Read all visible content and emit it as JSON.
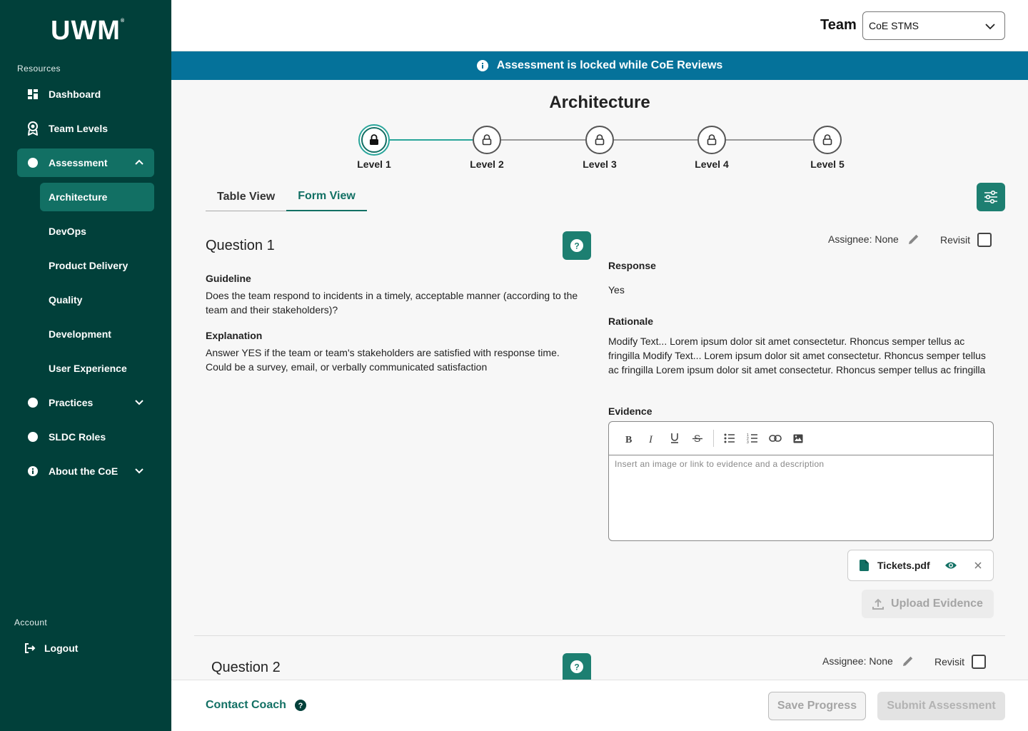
{
  "sidebar": {
    "logo": "UWM",
    "logo_mark": "®",
    "resources_label": "Resources",
    "items": {
      "dashboard": "Dashboard",
      "team_levels": "Team Levels",
      "assessment": "Assessment",
      "practices": "Practices",
      "sldc_roles": "SLDC Roles",
      "about": "About the CoE"
    },
    "sub_items": [
      "Architecture",
      "DevOps",
      "Product Delivery",
      "Quality",
      "Development",
      "User Experience"
    ],
    "active_sub_item": "Architecture",
    "account_label": "Account",
    "logout": "Logout"
  },
  "header": {
    "team_label": "Team",
    "team_value": "CoE STMS"
  },
  "banner": {
    "text": "Assessment is locked while CoE Reviews"
  },
  "page": {
    "title": "Architecture",
    "levels": [
      "Level 1",
      "Level 2",
      "Level 3",
      "Level 4",
      "Level 5"
    ],
    "current_level": "Level 1",
    "tabs": [
      "Table View",
      "Form View"
    ],
    "active_tab": "Form View"
  },
  "question1": {
    "title": "Question 1",
    "guideline_label": "Guideline",
    "guideline": "Does the team respond to incidents in a timely, acceptable manner (according to the team and their stakeholders)?",
    "explanation_label": "Explanation",
    "explanation": "Answer YES if the team or team's stakeholders are satisfied with response time. Could be a survey, email, or verbally communicated satisfaction",
    "assignee": "Assignee: None",
    "revisit": "Revisit",
    "revisit_checked": false,
    "response_label": "Response",
    "response": "Yes",
    "rationale_label": "Rationale",
    "rationale": "Modify Text... Lorem ipsum dolor sit amet consectetur. Rhoncus semper tellus ac fringilla Modify Text... Lorem ipsum dolor sit amet consectetur. Rhoncus semper tellus ac fringilla Lorem ipsum dolor sit amet consectetur. Rhoncus semper tellus ac fringilla",
    "evidence_label": "Evidence",
    "evidence_placeholder": "Insert an image or link to evidence and a description",
    "file_name": "Tickets.pdf",
    "upload_label": "Upload Evidence"
  },
  "question2": {
    "title": "Question 2",
    "assignee": "Assignee: None",
    "revisit": "Revisit",
    "revisit_checked": false
  },
  "footer": {
    "contact": "Contact Coach",
    "save": "Save Progress",
    "submit": "Submit Assessment"
  },
  "colors": {
    "sidebar_bg": "#01403a",
    "sidebar_active": "#127064",
    "banner_bg": "#05729a",
    "accent": "#1d7f71"
  }
}
